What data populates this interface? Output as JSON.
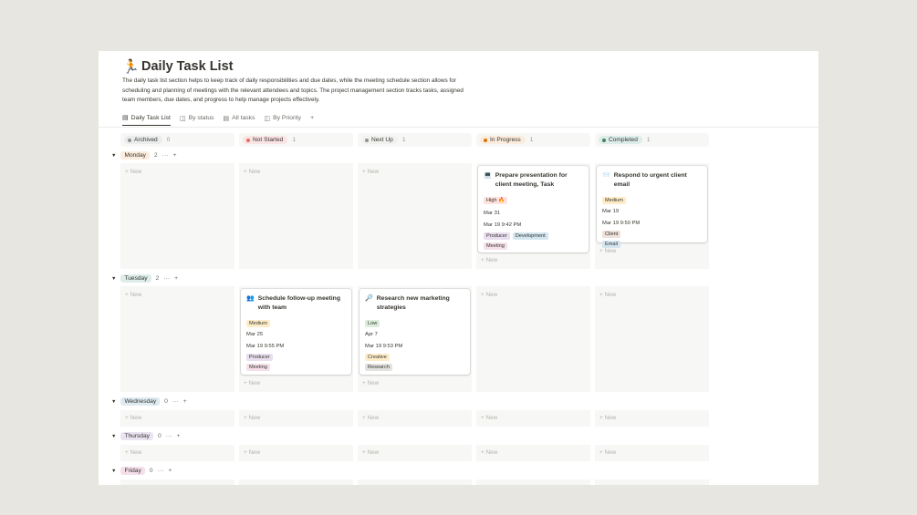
{
  "page": {
    "icon": "🏃",
    "title": "Daily Task List",
    "description": "The daily task list section helps to keep track of daily responsibilities and due dates, while the meeting schedule section allows for scheduling and planning of meetings with the relevant attendees and topics. The project management section tracks tasks, assigned team members, due dates, and progress to help manage projects effectively."
  },
  "tabs": [
    {
      "label": "Daily Task List",
      "icon": "table-icon"
    },
    {
      "label": "By status",
      "icon": "board-icon"
    },
    {
      "label": "All tasks",
      "icon": "table-icon"
    },
    {
      "label": "By Priority",
      "icon": "board-icon"
    },
    {
      "label": "+",
      "icon": "plus-icon"
    }
  ],
  "columns": [
    {
      "label": "Archived",
      "count": "0",
      "bg": "#ebeced",
      "dot": "#91918e",
      "text": "#37352f"
    },
    {
      "label": "Not Started",
      "count": "1",
      "bg": "#fbe4e4",
      "dot": "#e16f64",
      "text": "#37352f"
    },
    {
      "label": "Next Up",
      "count": "1",
      "bg": "#f1f1ef",
      "dot": "#91918e",
      "text": "#37352f"
    },
    {
      "label": "In Progress",
      "count": "1",
      "bg": "#fbecdd",
      "dot": "#d9730d",
      "text": "#37352f"
    },
    {
      "label": "Completed",
      "count": "1",
      "bg": "#ddedea",
      "dot": "#448361",
      "text": "#37352f"
    }
  ],
  "groups": [
    {
      "label": "Monday",
      "count": "2",
      "bg": "#fbecdd"
    },
    {
      "label": "Tuesday",
      "count": "2",
      "bg": "#ddedea"
    },
    {
      "label": "Wednesday",
      "count": "0",
      "bg": "#ddebf1"
    },
    {
      "label": "Thursday",
      "count": "0",
      "bg": "#eae4f2"
    },
    {
      "label": "Friday",
      "count": "0",
      "bg": "#f4dfeb"
    }
  ],
  "new_label": "+ New",
  "group_more": "···",
  "group_add": "+",
  "cards": {
    "presentation": {
      "icon": "💻",
      "title": "Prepare presentation for client meeting, Task",
      "priority": "High 🔥",
      "due": "Mar 31",
      "created": "Mar 19 9:42 PM",
      "tags": [
        "Producer",
        "Development",
        "Meeting"
      ]
    },
    "email": {
      "icon": "📨",
      "title": "Respond to urgent client email",
      "priority": "Medium",
      "due": "Mar 19",
      "created": "Mar 19 9:50 PM",
      "tags": [
        "Client",
        "Email"
      ]
    },
    "followup": {
      "icon": "👥",
      "title": "Schedule follow-up meeting with team",
      "priority": "Medium",
      "due": "Mar 25",
      "created": "Mar 19 9:55 PM",
      "tags": [
        "Producer",
        "Meeting"
      ]
    },
    "research": {
      "icon": "🔎",
      "title": "Research new marketing strategies",
      "priority": "Low",
      "due": "Apr 7",
      "created": "Mar 19 9:53 PM",
      "tags": [
        "Creative",
        "Research"
      ]
    }
  },
  "colors": {
    "high": "#ffe2dd",
    "medium": "#fdecc8",
    "low": "#dbeddb",
    "producer": "#e8deee",
    "development": "#d3e5ef",
    "meeting": "#f5e0e9",
    "client": "#eee0da",
    "email": "#d3e5ef",
    "creative": "#fdecc8",
    "research": "#e3e2e0"
  }
}
